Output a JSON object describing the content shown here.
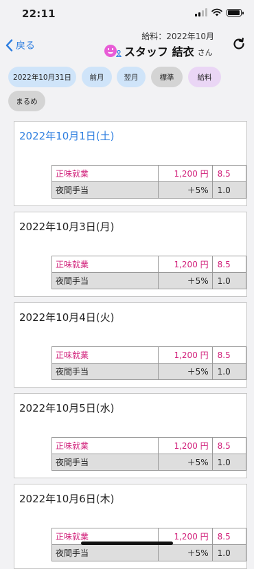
{
  "status": {
    "time": "22:11"
  },
  "nav": {
    "back_label": "戻る",
    "subtitle": "給料：2022年10月",
    "staff_name": "スタッフ 結衣",
    "honorific": "さん"
  },
  "chips": [
    {
      "label": "2022年10月31日"
    },
    {
      "label": "前月"
    },
    {
      "label": "翌月"
    },
    {
      "label": "標準"
    },
    {
      "label": "給料"
    },
    {
      "label": "まるめ"
    }
  ],
  "days": [
    {
      "date": "2022年10月1日(土)",
      "today": true,
      "rows": [
        {
          "type": "正味就業",
          "rate": "1,200 円",
          "extra": "8.5"
        },
        {
          "type": "夜間手当",
          "rate": "＋5%",
          "extra": "1.0"
        }
      ]
    },
    {
      "date": "2022年10月3日(月)",
      "today": false,
      "rows": [
        {
          "type": "正味就業",
          "rate": "1,200 円",
          "extra": "8.5"
        },
        {
          "type": "夜間手当",
          "rate": "＋5%",
          "extra": "1.0"
        }
      ]
    },
    {
      "date": "2022年10月4日(火)",
      "today": false,
      "rows": [
        {
          "type": "正味就業",
          "rate": "1,200 円",
          "extra": "8.5"
        },
        {
          "type": "夜間手当",
          "rate": "＋5%",
          "extra": "1.0"
        }
      ]
    },
    {
      "date": "2022年10月5日(水)",
      "today": false,
      "rows": [
        {
          "type": "正味就業",
          "rate": "1,200 円",
          "extra": "8.5"
        },
        {
          "type": "夜間手当",
          "rate": "＋5%",
          "extra": "1.0"
        }
      ]
    },
    {
      "date": "2022年10月6日(木)",
      "today": false,
      "rows": [
        {
          "type": "正味就業",
          "rate": "1,200 円",
          "extra": "8.5"
        },
        {
          "type": "夜間手当",
          "rate": "＋5%",
          "extra": "1.0"
        }
      ]
    }
  ],
  "icons": {
    "back": "chevron-left-icon",
    "refresh": "refresh-icon",
    "avatar": "smiley-avatar-icon",
    "person": "person-icon"
  },
  "colors": {
    "accent": "#2f7fe0",
    "pink_text": "#d11f7a",
    "chip_blue": "#cfe4f9",
    "chip_gray": "#d4d4d4",
    "chip_pink": "#ead6f5",
    "avatar": "#e85cd6"
  }
}
